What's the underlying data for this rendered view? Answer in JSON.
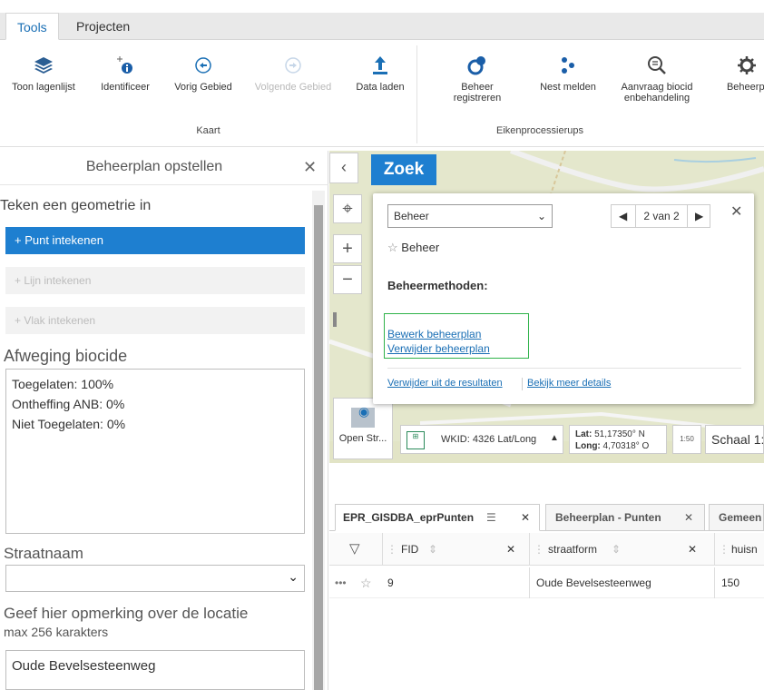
{
  "tabs": {
    "tools": "Tools",
    "projecten": "Projecten"
  },
  "ribbon": {
    "kaart": {
      "toon_lagenlijst": "Toon lagenlijst",
      "identificeer": "Identificeer",
      "vorig_gebied": "Vorig Gebied",
      "volgende_gebied": "Volgende Gebied",
      "data_laden": "Data laden",
      "group_label": "Kaart"
    },
    "eiken": {
      "beheer_registreren": "Beheer registreren",
      "nest_melden": "Nest melden",
      "aanvraag": "Aanvraag biocidenbehandeling",
      "beheerplan": "Beheerpl",
      "group_label": "Eikenprocessierups"
    }
  },
  "panel": {
    "title": "Beheerplan opstellen",
    "teken": "Teken een geometrie in",
    "punt": "+ Punt intekenen",
    "lijn": "+ Lijn intekenen",
    "vlak": "+ Vlak intekenen",
    "afweging_title": "Afweging biocide",
    "afweging": [
      "Toegelaten: 100%",
      "Ontheffing ANB: 0%",
      "Niet Toegelaten: 0%"
    ],
    "straatnaam_label": "Straatnaam",
    "opmerking_label": "Geef hier opmerking over de locatie",
    "max_label": "max 256 karakters",
    "opmerking_value": "Oude Bevelsesteenweg"
  },
  "map": {
    "search_button": "Zoek",
    "open_street": "Open Str...",
    "wkid": "WKID: 4326 Lat/Long",
    "lat_label": "Lat:",
    "lat_value": "51,17350° N",
    "long_label": "Long:",
    "long_value": "4,70318° O",
    "schaal": "Schaal 1:",
    "scale_icon": "1:50"
  },
  "popup": {
    "select_value": "Beheer",
    "pager": "2 van 2",
    "item_title": "Beheer",
    "methods_label": "Beheermethoden:",
    "bewerk": "Bewerk beheerplan",
    "verwijder": "Verwijder beheerplan",
    "verwijder_resultaten": "Verwijder uit de resultaten",
    "bekijk": "Bekijk meer details"
  },
  "grid": {
    "tabs": [
      "EPR_GISDBA_eprPunten",
      "Beheerplan - Punten",
      "Gemeen"
    ],
    "columns": [
      "FID",
      "straatform",
      "huisn"
    ],
    "row": {
      "fid": "9",
      "straat": "Oude Bevelsesteenweg",
      "huis": "150"
    }
  }
}
